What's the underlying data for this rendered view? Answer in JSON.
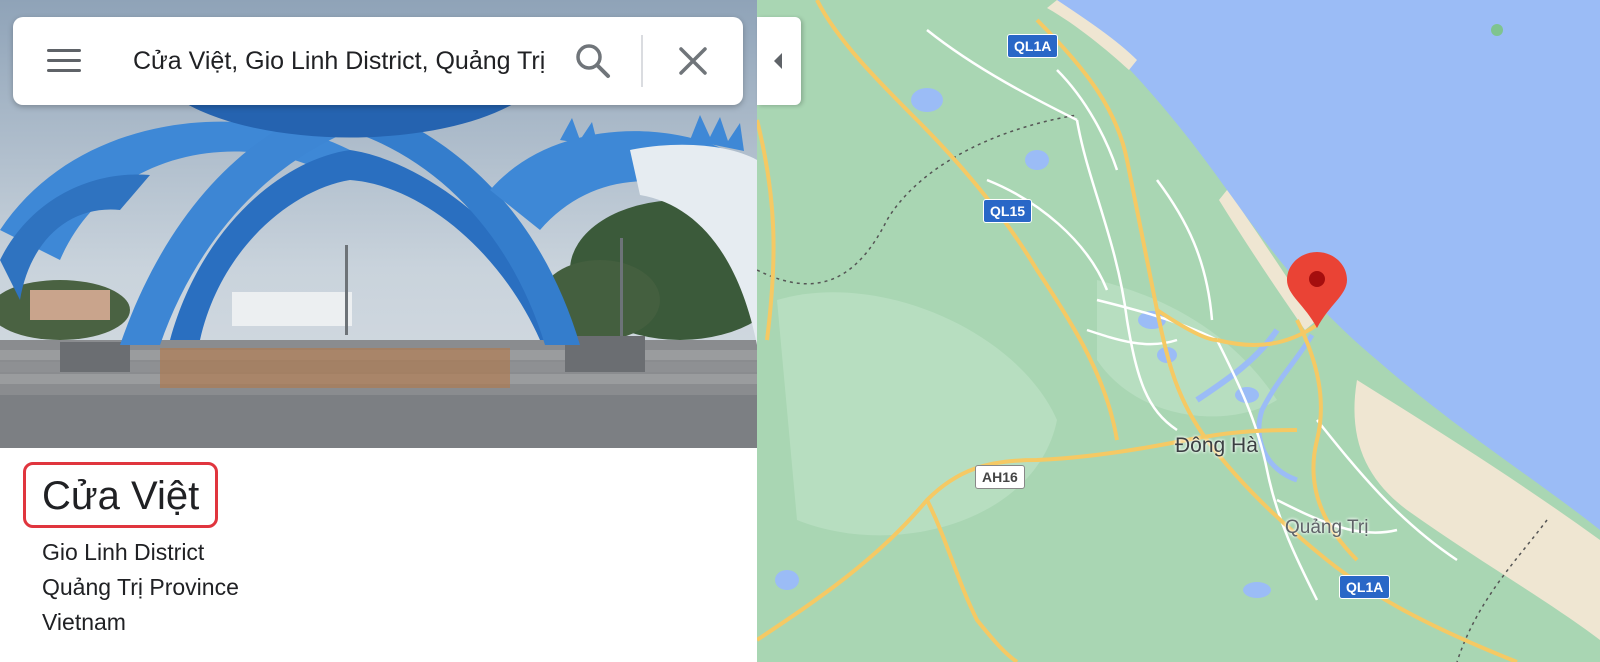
{
  "search": {
    "query": "Cửa Việt, Gio Linh District, Quảng Trị Province, Vietnam"
  },
  "place": {
    "name": "Cửa Việt",
    "address_lines": [
      "Gio Linh District",
      "Quảng Trị Province",
      "Vietnam"
    ]
  },
  "map": {
    "road_shields": {
      "ql1a_top": "QL1A",
      "ql15": "QL15",
      "ah16": "AH16",
      "ql1a_bottom": "QL1A"
    },
    "labels": {
      "dong_ha": "Đông Hà",
      "quang_tri": "Quảng Trị"
    },
    "colors": {
      "land": "#a9d6b3",
      "water": "#9bbcf6",
      "sand": "#efe6d2",
      "road": "#f5c964",
      "marker": "#ea4335",
      "highlight": "#e0353e"
    }
  },
  "icons": [
    "menu-icon",
    "search-icon",
    "close-icon",
    "collapse-arrow-icon",
    "map-pin-icon"
  ]
}
